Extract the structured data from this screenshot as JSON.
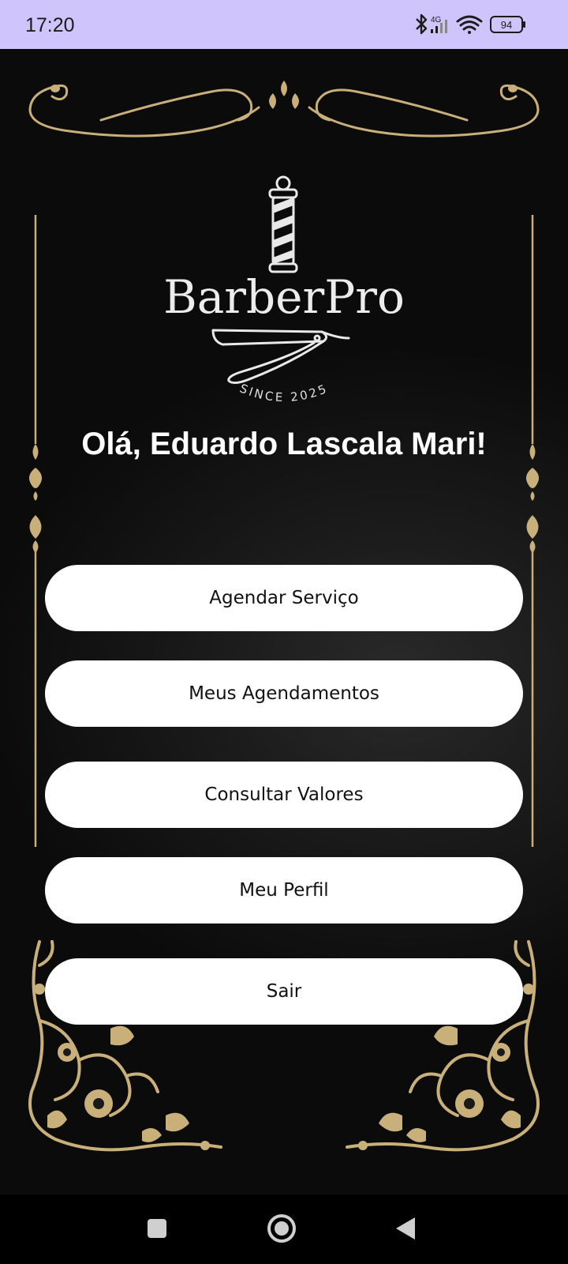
{
  "status_bar": {
    "time": "17:20",
    "network": "4G",
    "battery": "94",
    "icons": [
      "bluetooth-icon",
      "cellular-signal-icon",
      "wifi-icon",
      "battery-icon"
    ]
  },
  "app": {
    "logo": {
      "brand": "BarberPro",
      "tagline": "SINCE 2025"
    },
    "greeting": "Olá, Eduardo Lascala Mari!",
    "menu": [
      {
        "label": "Agendar Serviço"
      },
      {
        "label": "Meus Agendamentos"
      },
      {
        "label": "Consultar Valores"
      },
      {
        "label": "Meu Perfil"
      },
      {
        "label": "Sair"
      }
    ]
  },
  "nav_bar": {
    "icons": [
      "recents-square-icon",
      "home-circle-icon",
      "back-triangle-icon"
    ]
  },
  "colors": {
    "status_bar_bg": "#d0c4fc",
    "ornament_gold": "#c9b07a",
    "button_bg": "#ffffff"
  }
}
